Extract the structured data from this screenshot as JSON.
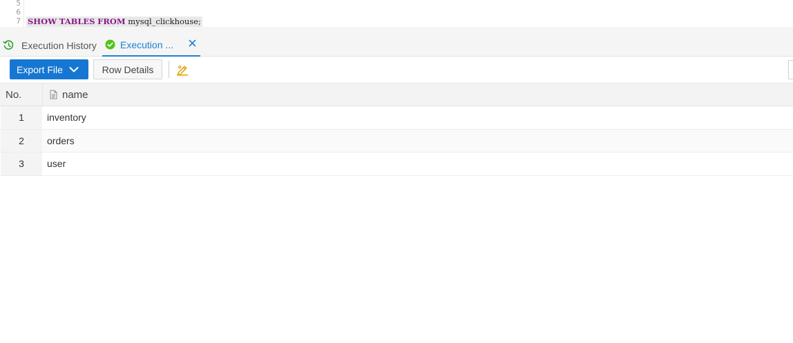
{
  "editor": {
    "line_numbers": [
      "5",
      "6",
      "7"
    ],
    "sql": {
      "keyword_show": "SHOW",
      "keyword_tables": "TABLES",
      "keyword_from": "FROM",
      "identifier": "mysql_clickhouse;"
    }
  },
  "tabs": [
    {
      "label": "Execution History",
      "icon": "history-icon"
    },
    {
      "label": "Execution ...",
      "icon": "success-check-icon",
      "active": true
    }
  ],
  "toolbar": {
    "export_label": "Export File",
    "row_details_label": "Row Details",
    "edit_icon": "edit-pencil-icon"
  },
  "table": {
    "columns": [
      "No.",
      "name"
    ],
    "rows": [
      {
        "no": "1",
        "name": "inventory"
      },
      {
        "no": "2",
        "name": "orders"
      },
      {
        "no": "3",
        "name": "user"
      }
    ]
  },
  "colors": {
    "accent": "#1677d2",
    "success": "#52c41a",
    "history_icon": "#3aa33a",
    "edit_icon": "#e0a000",
    "keyword": "#8a1a8a"
  }
}
